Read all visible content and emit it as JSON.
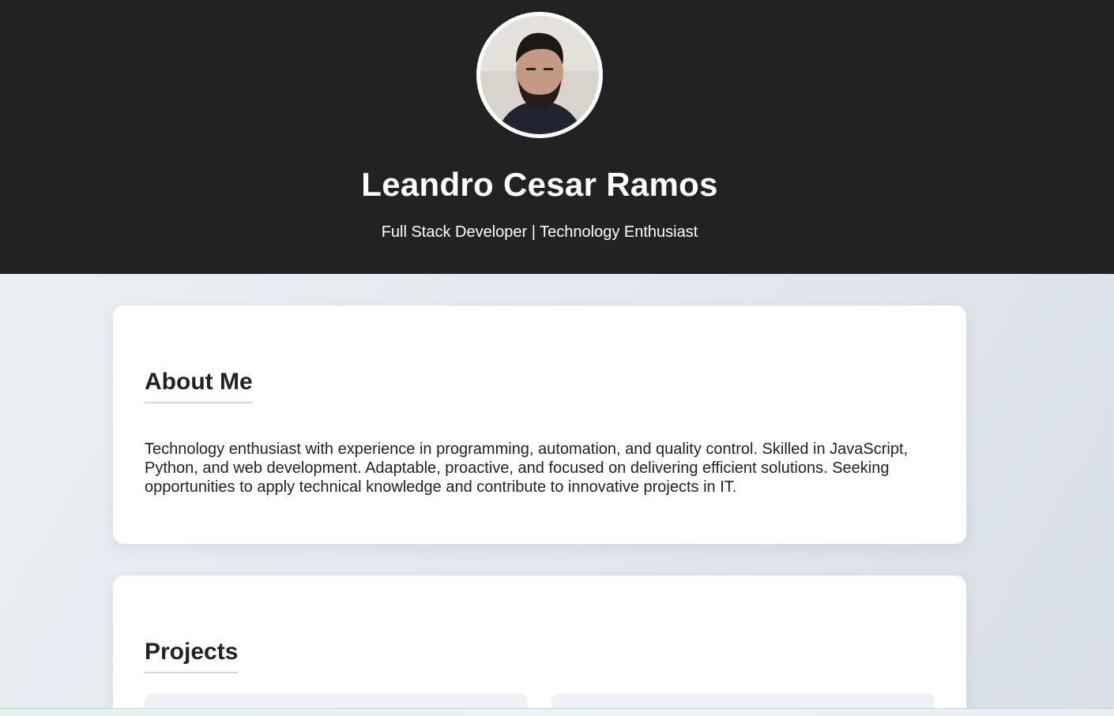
{
  "profile": {
    "name": "Leandro Cesar Ramos",
    "tagline": "Full Stack Developer | Technology Enthusiast"
  },
  "about": {
    "title": "About Me",
    "text": "Technology enthusiast with experience in programming, automation, and quality control. Skilled in JavaScript, Python, and web development. Adaptable, proactive, and focused on delivering efficient solutions. Seeking opportunities to apply technical knowledge and contribute to innovative projects in IT."
  },
  "projects": {
    "title": "Projects"
  },
  "colors": {
    "header_bg": "#222222",
    "card_bg": "#ffffff",
    "page_bg": "#e4e9ef",
    "text": "#222222"
  }
}
